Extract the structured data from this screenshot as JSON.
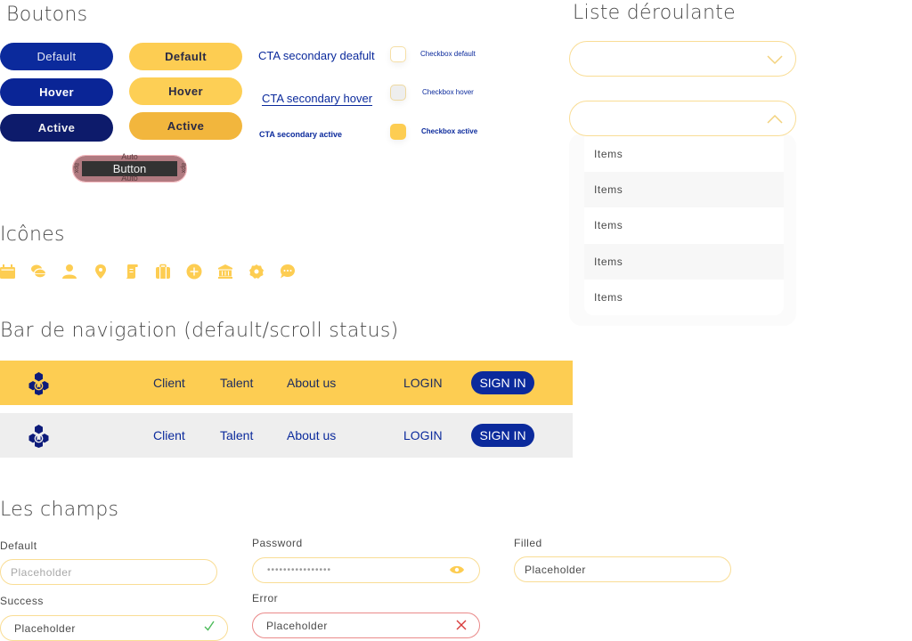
{
  "sections": {
    "buttons_title": "Boutons",
    "icons_title": "Icônes",
    "navbar_title": "Bar de navigation (default/scroll status)",
    "fields_title": "Les champs",
    "dropdown_title": "Liste déroulante"
  },
  "colors": {
    "primary_blue": "#0b2a9c",
    "primary_blue_active": "#0d1b6b",
    "accent_yellow": "#fdcd52",
    "accent_yellow_active": "#f2b63d",
    "scroll_nav_bg": "#eeeeee",
    "success": "#4cbb5a",
    "error": "#d83a3a"
  },
  "buttons": {
    "blue": [
      {
        "state": "default",
        "label": "Default"
      },
      {
        "state": "hover",
        "label": "Hover"
      },
      {
        "state": "active",
        "label": "Active"
      }
    ],
    "yellow": [
      {
        "state": "default",
        "label": "Default"
      },
      {
        "state": "hover",
        "label": "Hover"
      },
      {
        "state": "active",
        "label": "Active"
      }
    ],
    "cta_secondary": [
      {
        "state": "default",
        "label": "CTA secondary deafult"
      },
      {
        "state": "hover",
        "label": "CTA secondary hover"
      },
      {
        "state": "active",
        "label": "CTA secondary active"
      }
    ],
    "checkboxes": [
      {
        "state": "default",
        "label": "Checkbox default"
      },
      {
        "state": "hover",
        "label": "Checkbox hover"
      },
      {
        "state": "active",
        "label": "Checkbox active"
      }
    ],
    "spec": {
      "label": "Button",
      "padding_top_label": "Auto",
      "padding_bottom_label": "Auto",
      "padding_left_label": "8px",
      "padding_right_label": "8px"
    }
  },
  "icons": [
    "calendar-icon",
    "coins-icon",
    "user-icon",
    "location-pin-icon",
    "scroll-document-icon",
    "briefcase-icon",
    "plus-circle-icon",
    "bank-icon",
    "settings-icon",
    "chat-bubble-icon"
  ],
  "navbars": [
    {
      "status": "default",
      "links": [
        "Client",
        "Talent",
        "About us"
      ],
      "login": "LOGIN",
      "signin": "SIGN IN"
    },
    {
      "status": "scroll",
      "links": [
        "Client",
        "Talent",
        "About us"
      ],
      "login": "LOGIN",
      "signin": "SIGN IN"
    }
  ],
  "dropdown": {
    "closed": {
      "value": "",
      "chevron": "chevron-down"
    },
    "open": {
      "value": "",
      "chevron": "chevron-up"
    },
    "items": [
      "Items",
      "Items",
      "Items",
      "Items",
      "Items"
    ]
  },
  "fields": {
    "default": {
      "label": "Default",
      "placeholder": "Placeholder"
    },
    "password": {
      "label": "Password",
      "value": "••••••••••••••••"
    },
    "filled": {
      "label": "Filled",
      "value": "Placeholder"
    },
    "success": {
      "label": "Success",
      "value": "Placeholder"
    },
    "error": {
      "label": "Error",
      "value": "Placeholder"
    }
  }
}
